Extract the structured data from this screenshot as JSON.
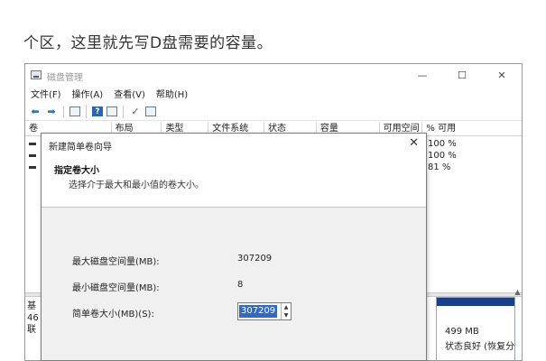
{
  "article": {
    "text": "个区，这里就先写D盘需要的容量。"
  },
  "window": {
    "title": "磁盘管理",
    "controls": {
      "minimize": "—",
      "maximize": "☐",
      "close": "✕"
    }
  },
  "menu": [
    "文件(F)",
    "操作(A)",
    "查看(V)",
    "帮助(H)"
  ],
  "toolbar_icons": [
    "back-arrow-icon",
    "forward-arrow-icon",
    "list-icon",
    "help-icon",
    "details-icon",
    "check-icon",
    "properties-icon"
  ],
  "volume_table": {
    "columns": [
      "卷",
      "布局",
      "类型",
      "文件系统",
      "状态",
      "容量",
      "可用空间",
      "% 可用"
    ],
    "rows": [
      {
        "percent": "100 %"
      },
      {
        "percent": "100 %"
      },
      {
        "percent": "81 %"
      }
    ]
  },
  "disk_panel": {
    "label_lines": [
      "基",
      "46",
      "联"
    ],
    "partition": {
      "size": "499 MB",
      "status": "状态良好 (恢复分"
    },
    "colors": {
      "stripe": "#1a3f8a"
    }
  },
  "wizard": {
    "title": "新建简单卷向导",
    "close": "✕",
    "heading": "指定卷大小",
    "subheading": "选择介于最大和最小值的卷大小。",
    "max_label": "最大磁盘空间量(MB):",
    "max_value": "307209",
    "min_label": "最小磁盘空间量(MB):",
    "min_value": "8",
    "size_label": "简单卷大小(MB)(S):",
    "size_value": "307209"
  },
  "colors": {
    "selection": "#3169c6",
    "help_icon": "#2b66b1"
  }
}
